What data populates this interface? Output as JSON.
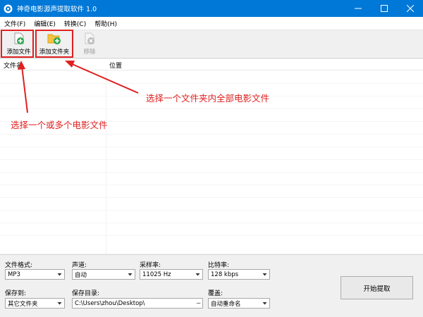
{
  "window": {
    "title": "神奇电影源声提取软件 1.0"
  },
  "menu": [
    "文件(F)",
    "编辑(E)",
    "转换(C)",
    "帮助(H)"
  ],
  "toolbar": {
    "add_file": "添加文件",
    "add_folder": "添加文件夹",
    "remove": "移除"
  },
  "list": {
    "col_name": "文件名",
    "col_location": "位置"
  },
  "annotations": {
    "folder_hint": "选择一个文件夹内全部电影文件",
    "file_hint": "选择一个或多个电影文件"
  },
  "settings": {
    "format_label": "文件格式:",
    "format_value": "MP3",
    "channel_label": "声道:",
    "channel_value": "自动",
    "samplerate_label": "采样率:",
    "samplerate_value": "11025 Hz",
    "bitrate_label": "比特率:",
    "bitrate_value": "128 kbps",
    "saveto_label": "保存到:",
    "saveto_value": "其它文件夹",
    "savedir_label": "保存目录:",
    "savedir_value": "C:\\Users\\zhou\\Desktop\\",
    "browse": "...",
    "overwrite_label": "覆盖:",
    "overwrite_value": "自动重命名"
  },
  "start_button": "开始提取",
  "colors": {
    "titlebar": "#0078d7",
    "annotation": "#e02020"
  }
}
